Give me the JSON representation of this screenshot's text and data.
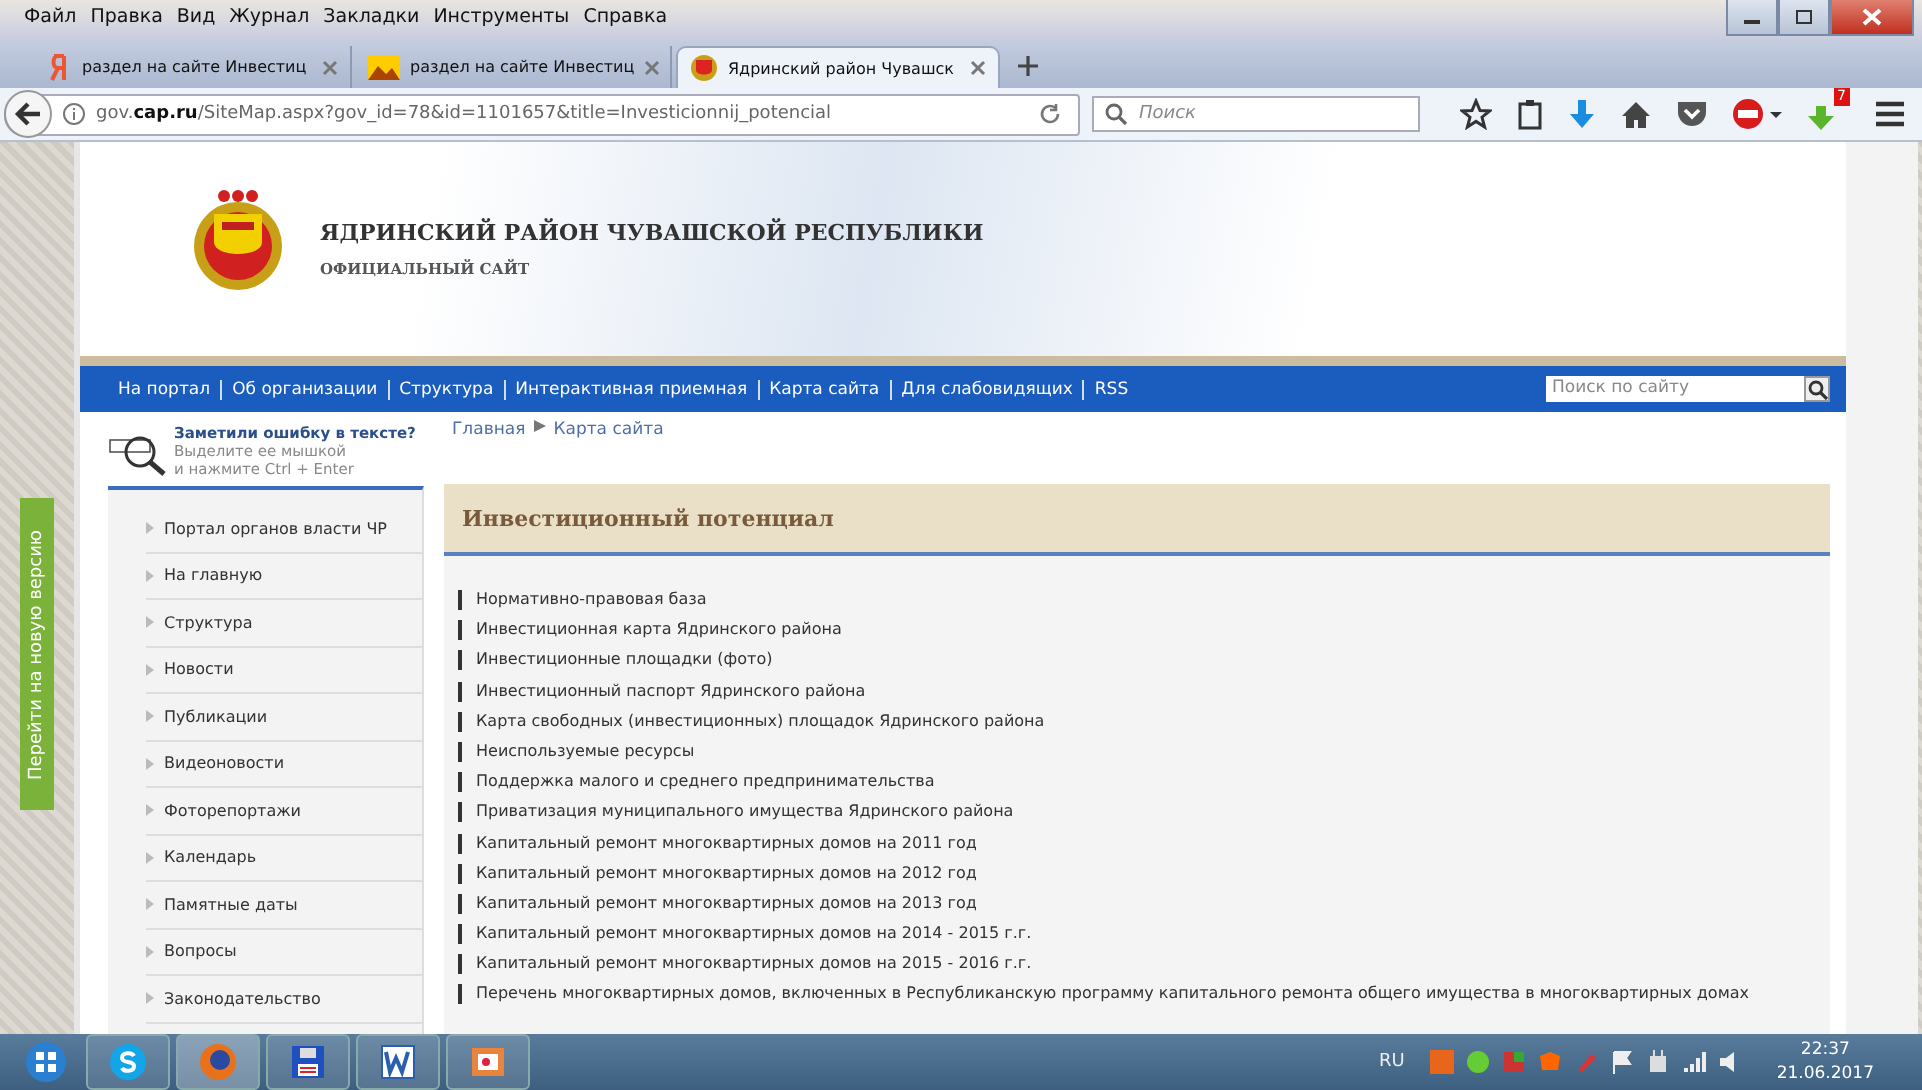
{
  "menu_bar": [
    "Файл",
    "Правка",
    "Вид",
    "Журнал",
    "Закладки",
    "Инструменты",
    "Справка"
  ],
  "tabs": [
    {
      "title": "раздел на сайте Инвестиц",
      "selected": false,
      "kind": "yandex"
    },
    {
      "title": "раздел на сайте Инвестиц",
      "selected": false,
      "kind": "image"
    },
    {
      "title": "Ядринский район Чувашск",
      "selected": true,
      "kind": "emblem"
    }
  ],
  "address": {
    "url": "gov.**cap.ru**/SiteMap.aspx?gov_id=78&id=1101657&title=Investicionnij_potencial"
  },
  "browser_search": {
    "placeholder": "Поиск"
  },
  "addon_badge": "7",
  "site": {
    "title": "ЯДРИНСКИЙ РАЙОН ЧУВАШСКОЙ РЕСПУБЛИКИ",
    "subtitle": "ОФИЦИАЛЬНЫЙ САЙТ",
    "nav": [
      "На портал",
      "Об организации",
      "Структура",
      "Интерактивная приемная",
      "Карта сайта",
      "Для слабовидящих",
      "RSS"
    ],
    "search": {
      "placeholder": "Поиск по сайту"
    },
    "error_notice": {
      "title": "Заметили ошибку в тексте?",
      "line_1": "Выделите ее мышкой",
      "line_2": "и нажмите Ctrl + Enter"
    },
    "breadcrumbs": [
      "Главная",
      "Карта сайта"
    ],
    "side_tab": "Перейти на новую версию",
    "sidebar": [
      "Портал органов власти ЧР",
      "На главную",
      "Структура",
      "Новости",
      "Публикации",
      "Видеоновости",
      "Фоторепортажи",
      "Календарь",
      "Памятные даты",
      "Вопросы",
      "Законодательство"
    ],
    "heading": "Инвестиционный потенциал",
    "links": [
      "Нормативно-правовая база",
      "Инвестиционная карта Ядринского района",
      "Инвестиционные площадки (фото)",
      "Инвестиционный паспорт Ядринского района",
      "Карта свободных (инвестиционных) площадок Ядринского района",
      "Неиспользуемые ресурсы",
      "Поддержка малого и среднего предпринимательства",
      "Приватизация муниципального имущества Ядринского района",
      "Капитальный ремонт многоквартирных домов на 2011 год",
      "Капитальный ремонт многоквартирных домов на 2012 год",
      "Капитальный ремонт многоквартирных домов на 2013 год",
      "Капитальный ремонт многоквартирных домов на 2014 - 2015 г.г.",
      "Капитальный ремонт многоквартирных домов на 2015 - 2016 г.г.",
      "Перечень многоквартирных домов, включенных в Республиканскую программу капитального ремонта общего имущества в многоквартирных домах"
    ]
  },
  "taskbar": {
    "language": "RU",
    "time": "22:37",
    "date": "21.06.2017"
  }
}
